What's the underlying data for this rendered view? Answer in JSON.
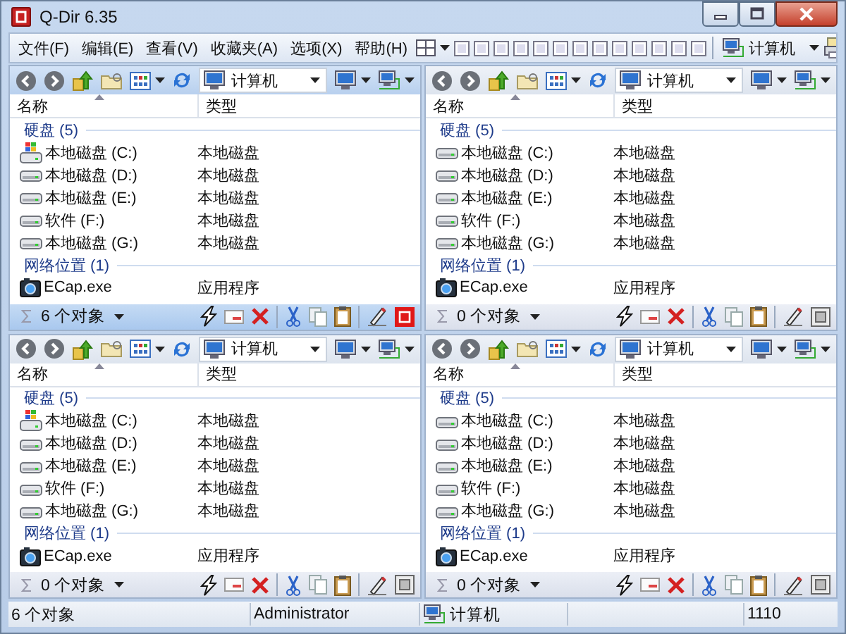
{
  "window": {
    "title": "Q-Dir 6.35"
  },
  "menu": [
    {
      "label": "文件(F)"
    },
    {
      "label": "编辑(E)"
    },
    {
      "label": "查看(V)"
    },
    {
      "label": "收藏夹(A)"
    },
    {
      "label": "选项(X)"
    },
    {
      "label": "帮助(H)"
    }
  ],
  "menu_toolbar": {
    "location": "计算机"
  },
  "panes": [
    {
      "active": true,
      "address": "计算机",
      "columns": [
        "名称",
        "类型"
      ],
      "groups": [
        {
          "title": "硬盘 (5)",
          "items": [
            {
              "name": "本地磁盘 (C:)",
              "type": "本地磁盘",
              "kind": "system-drive"
            },
            {
              "name": "本地磁盘 (D:)",
              "type": "本地磁盘",
              "kind": "drive"
            },
            {
              "name": "本地磁盘 (E:)",
              "type": "本地磁盘",
              "kind": "drive"
            },
            {
              "name": "软件 (F:)",
              "type": "本地磁盘",
              "kind": "drive"
            },
            {
              "name": "本地磁盘 (G:)",
              "type": "本地磁盘",
              "kind": "drive"
            }
          ]
        },
        {
          "title": "网络位置 (1)",
          "items": [
            {
              "name": "ECap.exe",
              "type": "应用程序",
              "kind": "program"
            }
          ]
        }
      ],
      "count": "6 个对象"
    },
    {
      "active": false,
      "address": "计算机",
      "columns": [
        "名称",
        "类型"
      ],
      "groups": [
        {
          "title": "硬盘 (5)",
          "items": [
            {
              "name": "本地磁盘 (C:)",
              "type": "本地磁盘",
              "kind": "drive"
            },
            {
              "name": "本地磁盘 (D:)",
              "type": "本地磁盘",
              "kind": "drive"
            },
            {
              "name": "本地磁盘 (E:)",
              "type": "本地磁盘",
              "kind": "drive"
            },
            {
              "name": "软件 (F:)",
              "type": "本地磁盘",
              "kind": "drive"
            },
            {
              "name": "本地磁盘 (G:)",
              "type": "本地磁盘",
              "kind": "drive"
            }
          ]
        },
        {
          "title": "网络位置 (1)",
          "items": [
            {
              "name": "ECap.exe",
              "type": "应用程序",
              "kind": "program"
            }
          ]
        }
      ],
      "count": "0 个对象"
    },
    {
      "active": false,
      "address": "计算机",
      "columns": [
        "名称",
        "类型"
      ],
      "groups": [
        {
          "title": "硬盘 (5)",
          "items": [
            {
              "name": "本地磁盘 (C:)",
              "type": "本地磁盘",
              "kind": "system-drive"
            },
            {
              "name": "本地磁盘 (D:)",
              "type": "本地磁盘",
              "kind": "drive"
            },
            {
              "name": "本地磁盘 (E:)",
              "type": "本地磁盘",
              "kind": "drive"
            },
            {
              "name": "软件 (F:)",
              "type": "本地磁盘",
              "kind": "drive"
            },
            {
              "name": "本地磁盘 (G:)",
              "type": "本地磁盘",
              "kind": "drive"
            }
          ]
        },
        {
          "title": "网络位置 (1)",
          "items": [
            {
              "name": "ECap.exe",
              "type": "应用程序",
              "kind": "program"
            }
          ]
        }
      ],
      "count": "0 个对象"
    },
    {
      "active": false,
      "address": "计算机",
      "columns": [
        "名称",
        "类型"
      ],
      "groups": [
        {
          "title": "硬盘 (5)",
          "items": [
            {
              "name": "本地磁盘 (C:)",
              "type": "本地磁盘",
              "kind": "drive"
            },
            {
              "name": "本地磁盘 (D:)",
              "type": "本地磁盘",
              "kind": "drive"
            },
            {
              "name": "本地磁盘 (E:)",
              "type": "本地磁盘",
              "kind": "drive"
            },
            {
              "name": "软件 (F:)",
              "type": "本地磁盘",
              "kind": "drive"
            },
            {
              "name": "本地磁盘 (G:)",
              "type": "本地磁盘",
              "kind": "drive"
            }
          ]
        },
        {
          "title": "网络位置 (1)",
          "items": [
            {
              "name": "ECap.exe",
              "type": "应用程序",
              "kind": "program"
            }
          ]
        }
      ],
      "count": "0 个对象"
    }
  ],
  "status_bar": {
    "count": "6 个对象",
    "user": "Administrator",
    "location": "计算机",
    "value": "1110"
  }
}
